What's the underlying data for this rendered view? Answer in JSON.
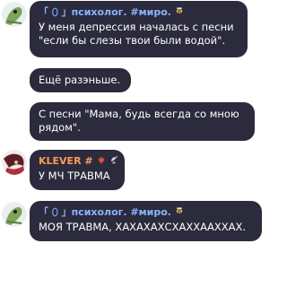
{
  "messages": [
    {
      "author": "「 ⬯ 」психолог. #миро.",
      "author_icon": "bee-icon",
      "text": "У меня депрессия началась с песни \"если бы слезы твои были водой\"."
    },
    {
      "text": "Ещё разэньше."
    },
    {
      "text": "С песни \"Мама, будь всегда со мною рядом\"."
    },
    {
      "author": "KLEVER #",
      "author_icons": [
        "strawberry-icon",
        "satellite-dish-icon"
      ],
      "text": "У МЧ ТРАВМА"
    },
    {
      "author": "「 ⬯ 」психолог. #миро.",
      "author_icon": "bee-icon",
      "text": "МОЯ ТРАВМА, ХАХАХАХСХАХХААХХАХ."
    }
  ],
  "colors": {
    "bubble": "#2b2b3d",
    "psychologist_name": "#8ab4ff",
    "klever_name": "#ff9a5a",
    "text": "#ffffff"
  }
}
